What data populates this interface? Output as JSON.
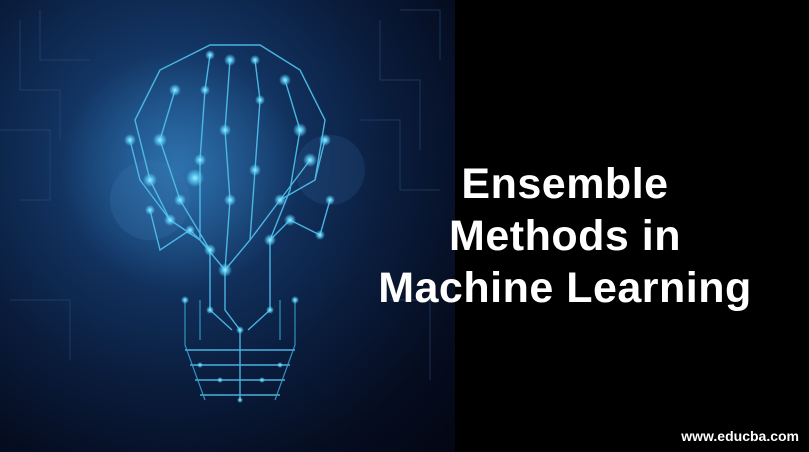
{
  "headline": {
    "line1": "Ensemble",
    "line2": "Methods in",
    "line3": "Machine Learning"
  },
  "site_url": "www.educba.com",
  "colors": {
    "background_right": "#000000",
    "background_left": "#0a1c3c",
    "circuit_glow": "#5fd6ff",
    "text": "#ffffff"
  },
  "icons": [
    "circuit-lightbulb-illustration"
  ]
}
